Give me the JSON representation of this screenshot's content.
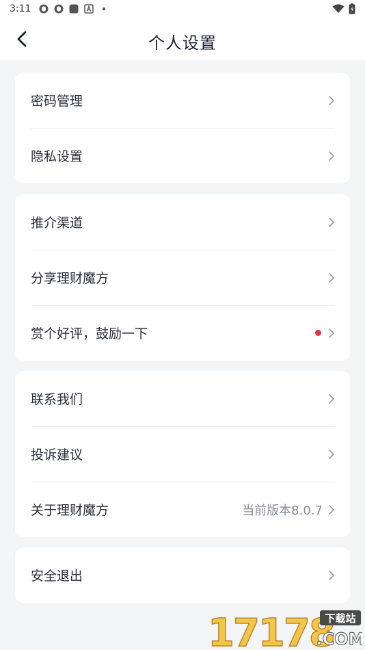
{
  "status_bar": {
    "time": "3:11",
    "icons": [
      "sync-icon",
      "sync-icon",
      "square-app-icon",
      "font-a-icon",
      "dot-icon"
    ],
    "right_icons": [
      "wifi-icon",
      "battery-icon"
    ]
  },
  "header": {
    "title": "个人设置",
    "back_icon": "chevron-left-icon"
  },
  "groups": [
    {
      "items": [
        {
          "label": "密码管理"
        },
        {
          "label": "隐私设置"
        }
      ]
    },
    {
      "items": [
        {
          "label": "推介渠道"
        },
        {
          "label": "分享理财魔方"
        },
        {
          "label": "赏个好评，鼓励一下",
          "badge": "red-dot"
        }
      ]
    },
    {
      "items": [
        {
          "label": "联系我们"
        },
        {
          "label": "投诉建议"
        },
        {
          "label": "关于理财魔方",
          "value": "当前版本8.0.7"
        }
      ]
    },
    {
      "items": [
        {
          "label": "安全退出"
        }
      ]
    }
  ],
  "colors": {
    "background": "#f4f5f7",
    "card": "#ffffff",
    "text": "#2a2d3a",
    "muted": "#8a8d99",
    "badge": "#e8333a"
  },
  "watermark": {
    "number": "17178",
    "tag": "下载站",
    "domain": ".COM"
  }
}
